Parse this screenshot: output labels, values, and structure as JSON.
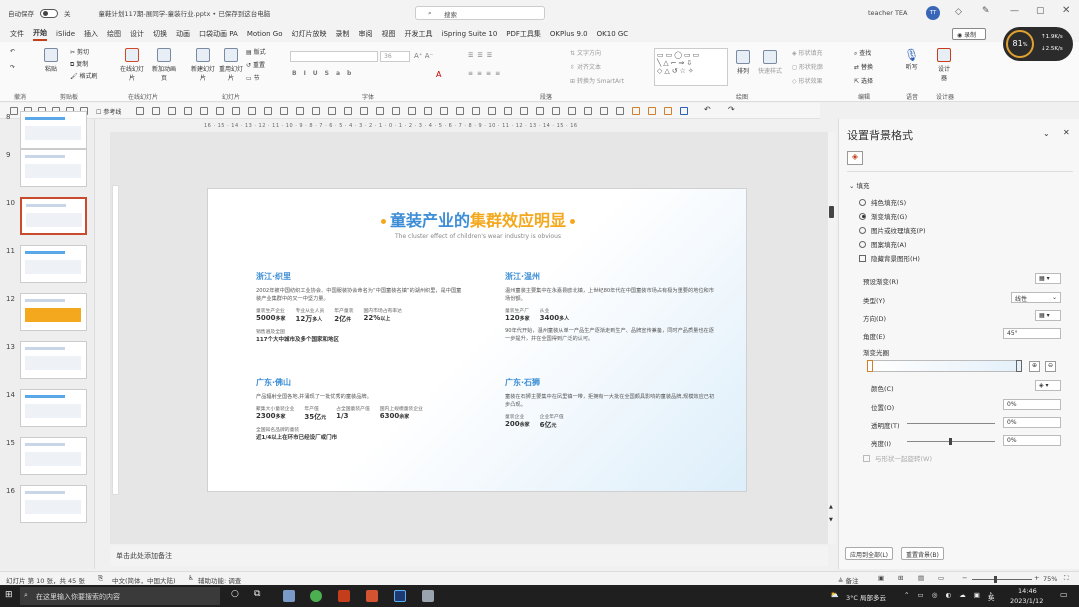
{
  "titlebar": {
    "autosave": "自动保存",
    "autosave_state": "关",
    "filename": "童鞋计划117期-展同学-童装行业.pptx • 已保存到这台电脑",
    "search_placeholder": "搜索",
    "user": "teacher TEA",
    "avatar": "TT"
  },
  "menu": [
    "文件",
    "开始",
    "iSlide",
    "插入",
    "绘图",
    "设计",
    "切换",
    "动画",
    "口袋动画 PA",
    "Motion Go",
    "幻灯片放映",
    "录制",
    "审阅",
    "视图",
    "开发工具",
    "iSpring Suite 10",
    "PDF工具集",
    "OKPlus 9.0",
    "OK10 GC"
  ],
  "menu_active": "开始",
  "record_btn": "录制",
  "ribbon": {
    "undo": "撤销",
    "paste": "粘贴",
    "cut": "剪切",
    "copy": "复制",
    "format_painter": "格式刷",
    "slides_online": "在线幻灯片",
    "new_anim": "新加动画页",
    "new_slide": "新建幻灯片",
    "reuse_slide": "重用幻灯片",
    "layout": "版式",
    "reset": "重置",
    "section": "节",
    "font_size": "36",
    "text_dir": "文字方向",
    "align_text": "对齐文本",
    "smartart": "转换为 SmartArt",
    "arrange": "排列",
    "quick_styles": "快速样式",
    "shape_fill": "形状填充",
    "shape_outline": "形状轮廓",
    "shape_effect": "形状效果",
    "find": "查找",
    "replace": "替换",
    "select": "选择",
    "dictate": "听写",
    "designer": "设计器",
    "groups": [
      "撤消",
      "剪贴板",
      "在线幻灯片",
      "幻灯片",
      "字体",
      "段落",
      "绘图",
      "编辑",
      "语音",
      "设计器"
    ]
  },
  "perf": {
    "percent": "81",
    "unit": "%",
    "up": "1.9",
    "up_unit": "K/s",
    "down": "2.5",
    "down_unit": "K/s"
  },
  "qat": {
    "reference_line": "参考线"
  },
  "thumbnails": [
    {
      "num": "8"
    },
    {
      "num": "9"
    },
    {
      "num": "10",
      "selected": true
    },
    {
      "num": "11"
    },
    {
      "num": "12"
    },
    {
      "num": "13"
    },
    {
      "num": "14"
    },
    {
      "num": "15"
    },
    {
      "num": "16"
    }
  ],
  "ruler": "16 · 15 · 14 · 13 · 12 · 11 · 10 · 9 · 8 · 7 · 6 · 5 · 4 · 3 · 2 · 1 · 0 · 1 · 2 · 3 · 4 · 5 · 6 · 7 · 8 · 9 · 10 · 11 · 12 · 13 · 14 · 15 · 16",
  "slide": {
    "title_a": "童装产业的",
    "title_b": "集群效应明显",
    "subtitle": "The cluster effect of children's wear industry is obvious",
    "sections": [
      {
        "title": "浙江·织里",
        "para": "2002年被中国纺织工业协会、中国服装协会命名为“中国童装名镇”的湖州织里，是中国童装产业集群中的又一中坚力量。",
        "stats": [
          {
            "label": "童装生产企业",
            "value": "5000",
            "unit": "多家"
          },
          {
            "label": "专业从业人员",
            "value": "12万",
            "unit": "多人"
          },
          {
            "label": "年产童装",
            "value": "2亿",
            "unit": "件"
          },
          {
            "label": "国内市场占有率达",
            "value": "22%",
            "unit": "以上"
          }
        ],
        "extra_label": "销售遍及全国",
        "extra_value": "117个大中城市及多个国家和地区"
      },
      {
        "title": "浙江·温州",
        "para": "温州童装主要集中在永嘉县欧北镇，上世纪80年代在中国童装市场占有极为重要的地位和市场份额。",
        "stats": [
          {
            "label": "童装生产厂",
            "value": "120",
            "unit": "多家"
          },
          {
            "label": "从业",
            "value": "3400",
            "unit": "多人"
          }
        ],
        "extra_label": "",
        "extra_value": "90年代开始，温州童装从单一产品生产逐渐走到生产、品牌宣传兼备，同时产品质量也在逐一步提升，并在全国得到广泛的认可。"
      },
      {
        "title": "广东·佛山",
        "para": "产品辐射全国各地,并涌现了一批优秀的童装品牌。",
        "stats": [
          {
            "label": "聚集大小童装企业",
            "value": "2300",
            "unit": "多家"
          },
          {
            "label": "年产值",
            "value": "35亿",
            "unit": "元"
          },
          {
            "label": "占全国童装产值",
            "value": "1/3",
            "unit": ""
          },
          {
            "label": "国内上规模童装企业",
            "value": "6300",
            "unit": "余家"
          }
        ],
        "extra_label": "全国知名品牌的童装",
        "extra_value": "近1/4以上在环市已经设厂或门市"
      },
      {
        "title": "广东·石狮",
        "para": "童装在石狮主要集中在凤里镇一带，拒拥有一大批在全国颇具影响的童装品牌,规模效应已初步凸现。",
        "stats": [
          {
            "label": "童装企业",
            "value": "200",
            "unit": "余家"
          },
          {
            "label": "企业年产值",
            "value": "6亿",
            "unit": "元"
          }
        ],
        "extra_label": "",
        "extra_value": ""
      }
    ]
  },
  "notes_placeholder": "单击此处添加备注",
  "pane": {
    "title": "设置背景格式",
    "section": "填充",
    "fills": [
      {
        "label": "纯色填充(S)",
        "on": false
      },
      {
        "label": "渐变填充(G)",
        "on": true
      },
      {
        "label": "图片或纹理填充(P)",
        "on": false
      },
      {
        "label": "图案填充(A)",
        "on": false
      }
    ],
    "hide_bg": "隐藏背景图形(H)",
    "preset": "预设渐变(R)",
    "type_lbl": "类型(Y)",
    "type_val": "线性",
    "dir_lbl": "方向(D)",
    "angle_lbl": "角度(E)",
    "angle_val": "45°",
    "stops_lbl": "渐变光圈",
    "color_lbl": "颜色(C)",
    "pos_lbl": "位置(O)",
    "pos_val": "0%",
    "trans_lbl": "透明度(T)",
    "trans_val": "0%",
    "bright_lbl": "亮度(I)",
    "bright_val": "0%",
    "rotate_lbl": "与形状一起旋转(W)",
    "apply_all": "应用到全部(L)",
    "reset_bg": "重置背景(B)"
  },
  "status": {
    "slide_info": "幻灯片 第 10 张，共 45 张",
    "lang": "中文(简体，中国大陆)",
    "accessibility": "辅助功能: 调查",
    "notes": "备注",
    "zoom": "75%"
  },
  "taskbar": {
    "search": "在这里输入你要搜索的内容",
    "weather": "3°C 局部多云",
    "time": "14:46",
    "date": "2023/1/12",
    "ime": "英"
  }
}
